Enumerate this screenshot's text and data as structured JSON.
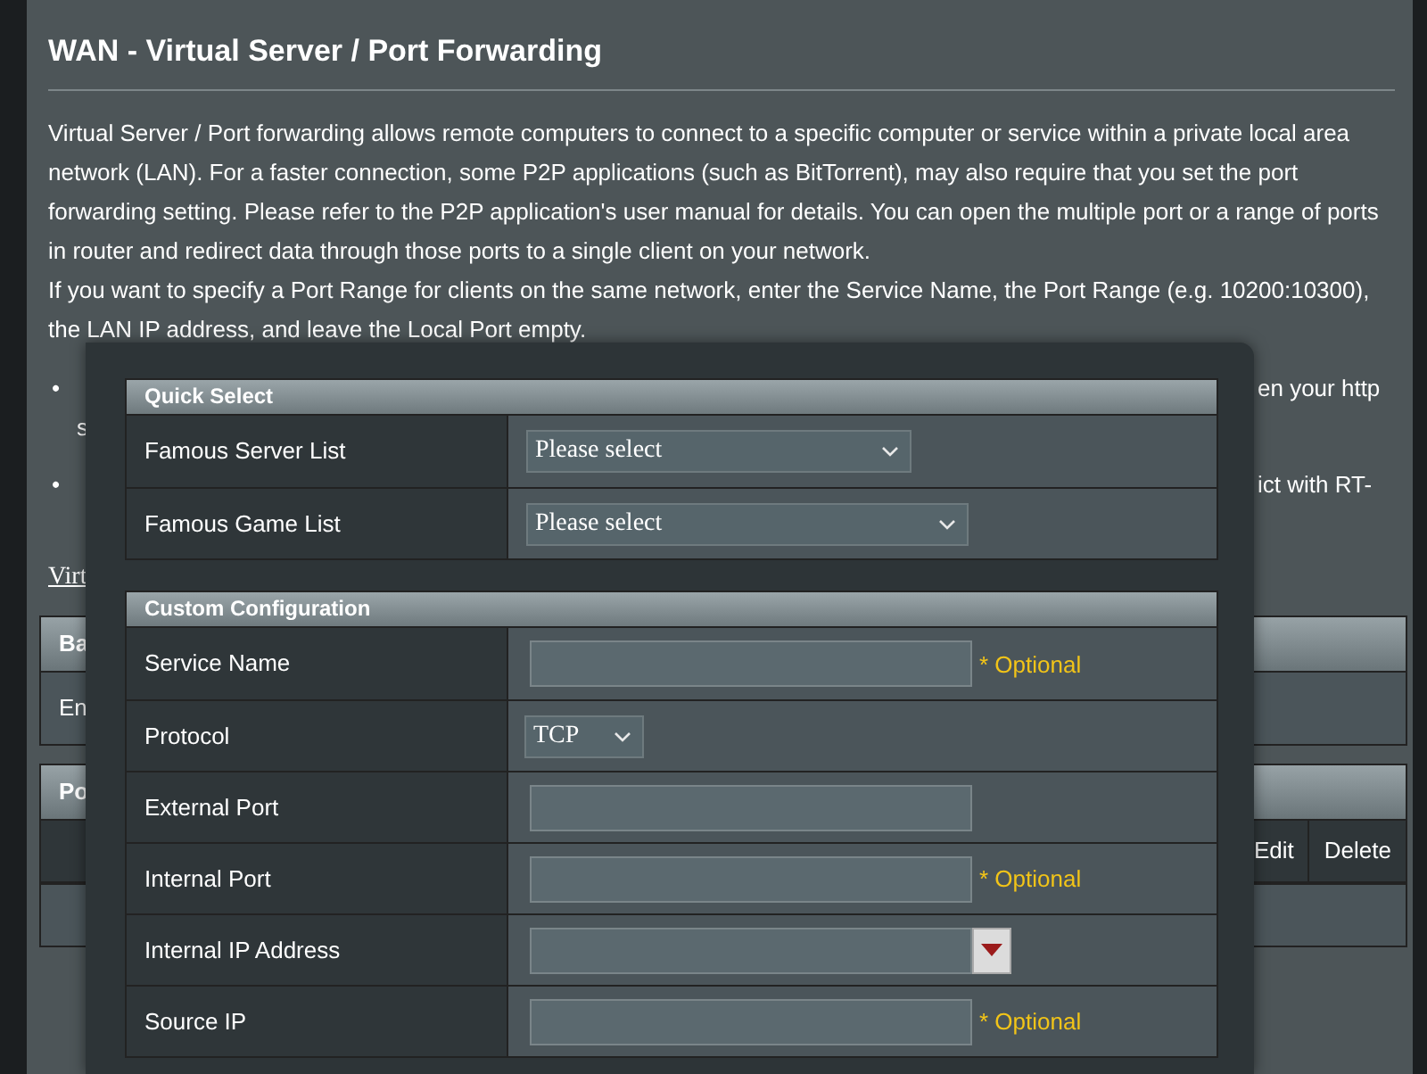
{
  "page": {
    "title": "WAN - Virtual Server / Port Forwarding",
    "paragraphs": [
      "Virtual Server / Port forwarding allows remote computers to connect to a specific computer or service within a private local area network (LAN). For a faster connection, some P2P applications (such as BitTorrent), may also require that you set the port forwarding setting. Please refer to the P2P application's user manual for details. You can open the multiple port or a range of ports in router and redirect data through those ports to a single client on your network.",
      "If you want to specify a Port Range for clients on the same network, enter the Service Name, the Port Range (e.g. 10200:10300), the LAN IP address, and leave the Local Port empty."
    ],
    "notes": [
      {
        "bullet": "•",
        "tail": "en your http",
        "continuation": "s"
      },
      {
        "bullet": "•",
        "tail": "ict with RT-"
      }
    ],
    "link": "Virt",
    "sections": [
      {
        "kind": "settings",
        "title": "Ba",
        "cells": [
          "En"
        ]
      },
      {
        "kind": "list",
        "title": "Po",
        "cells": [
          "Edit",
          "Delete"
        ]
      }
    ]
  },
  "dialog": {
    "groups": [
      {
        "title": "Quick Select",
        "rows": [
          {
            "label": "Famous Server List",
            "kind": "select",
            "value": "Please select"
          },
          {
            "label": "Famous Game List",
            "kind": "select",
            "value": "Please select"
          }
        ]
      },
      {
        "title": "Custom Configuration",
        "rows": [
          {
            "label": "Service Name",
            "kind": "text",
            "hint": "* Optional"
          },
          {
            "label": "Protocol",
            "kind": "select",
            "value": "TCP"
          },
          {
            "label": "External Port",
            "kind": "text"
          },
          {
            "label": "Internal Port",
            "kind": "text",
            "hint": "* Optional"
          },
          {
            "label": "Internal IP Address",
            "kind": "combo"
          },
          {
            "label": "Source IP",
            "kind": "text",
            "hint": "* Optional"
          }
        ]
      }
    ]
  }
}
